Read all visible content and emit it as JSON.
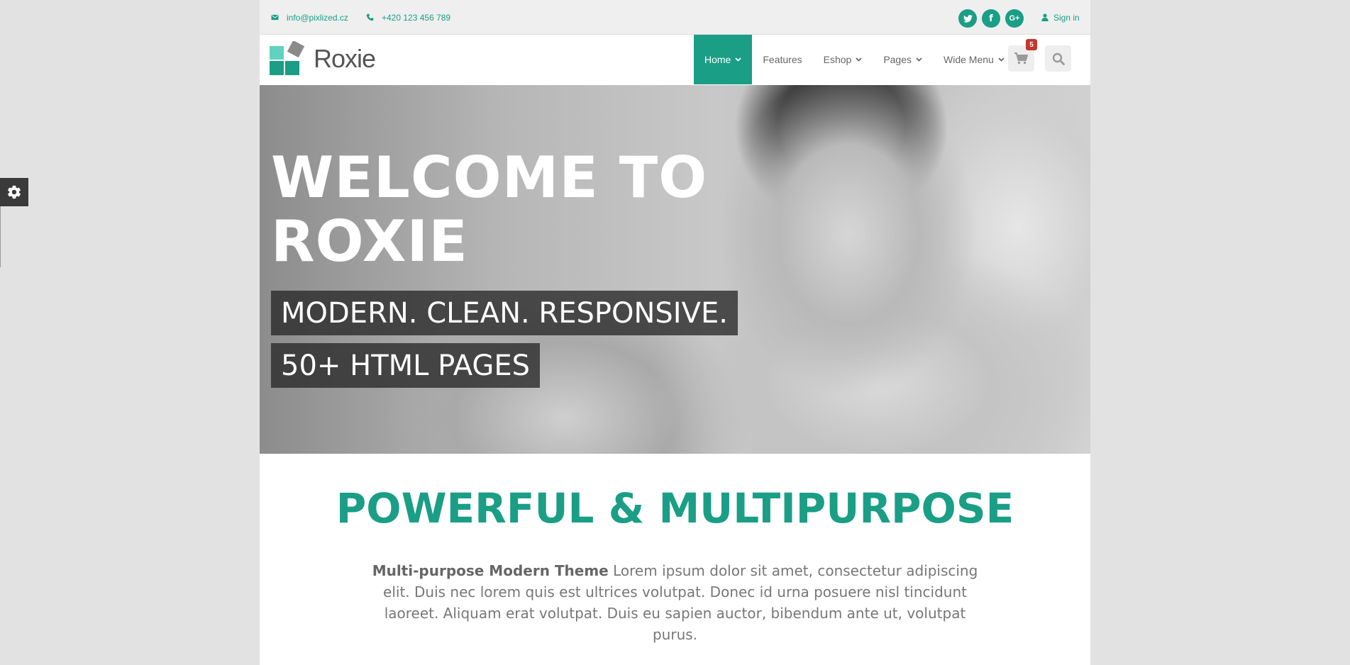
{
  "topbar": {
    "email": "info@pixlized.cz",
    "phone": "+420 123 456 789",
    "social": [
      {
        "icon": "twitter-icon",
        "glyph": "t"
      },
      {
        "icon": "facebook-icon",
        "glyph": "f"
      },
      {
        "icon": "google-plus-icon",
        "glyph": "G+"
      }
    ],
    "signin": "Sign in"
  },
  "brand": {
    "name": "Roxie",
    "accent": "#1a9e86",
    "logo_colors": [
      "#5fd3bf",
      "#1a9e86",
      "#8a8a8a"
    ]
  },
  "nav": {
    "items": [
      {
        "label": "Home",
        "active": true,
        "dropdown": true
      },
      {
        "label": "Features",
        "active": false,
        "dropdown": false
      },
      {
        "label": "Eshop",
        "active": false,
        "dropdown": true
      },
      {
        "label": "Pages",
        "active": false,
        "dropdown": true
      },
      {
        "label": "Wide Menu",
        "active": false,
        "dropdown": true
      }
    ],
    "cart_count": "5",
    "cart_icon": "shopping-cart-icon",
    "search_icon": "search-icon"
  },
  "hero": {
    "title_line1": "WELCOME TO",
    "title_line2": "ROXIE",
    "tagline1": "MODERN. CLEAN. RESPONSIVE.",
    "tagline2": "50+ HTML PAGES"
  },
  "intro": {
    "title": "POWERFUL & MULTIPURPOSE",
    "lead": "Multi-purpose Modern Theme",
    "body": " Lorem ipsum dolor sit amet, consectetur adipiscing elit. Duis nec lorem quis est ultrices volutpat. Donec id urna posuere nisl tincidunt laoreet. Aliquam erat volutpat. Duis eu sapien auctor, bibendum ante ut, volutpat purus."
  },
  "settings_panel_icon": "gear-icon"
}
